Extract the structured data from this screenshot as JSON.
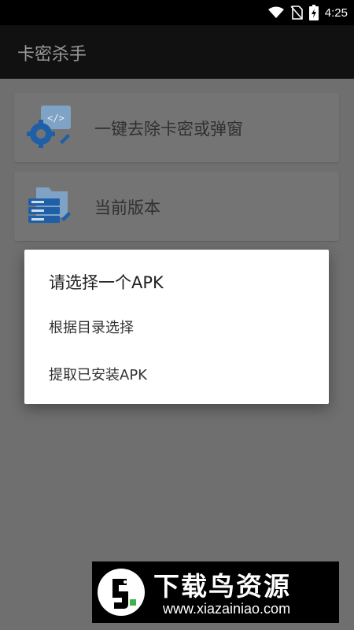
{
  "status_bar": {
    "time": "4:25",
    "icons": [
      "wifi-icon",
      "no-sim-icon",
      "battery-charging-icon"
    ]
  },
  "app_bar": {
    "title": "卡密杀手"
  },
  "cards": [
    {
      "label": "一键去除卡密或弹窗",
      "icon": "settings-code-icon"
    },
    {
      "label": "当前版本",
      "icon": "server-folder-icon"
    }
  ],
  "dialog": {
    "title": "请选择一个APK",
    "options": [
      "根据目录选择",
      "提取已安装APK"
    ]
  },
  "watermark": {
    "title": "下载鸟资源",
    "url": "www.xiazainiao.com"
  },
  "colors": {
    "scrim": "#707070",
    "app_bar": "#111111",
    "dialog_bg": "#ffffff",
    "icon_blue": "#1f6fc4"
  }
}
